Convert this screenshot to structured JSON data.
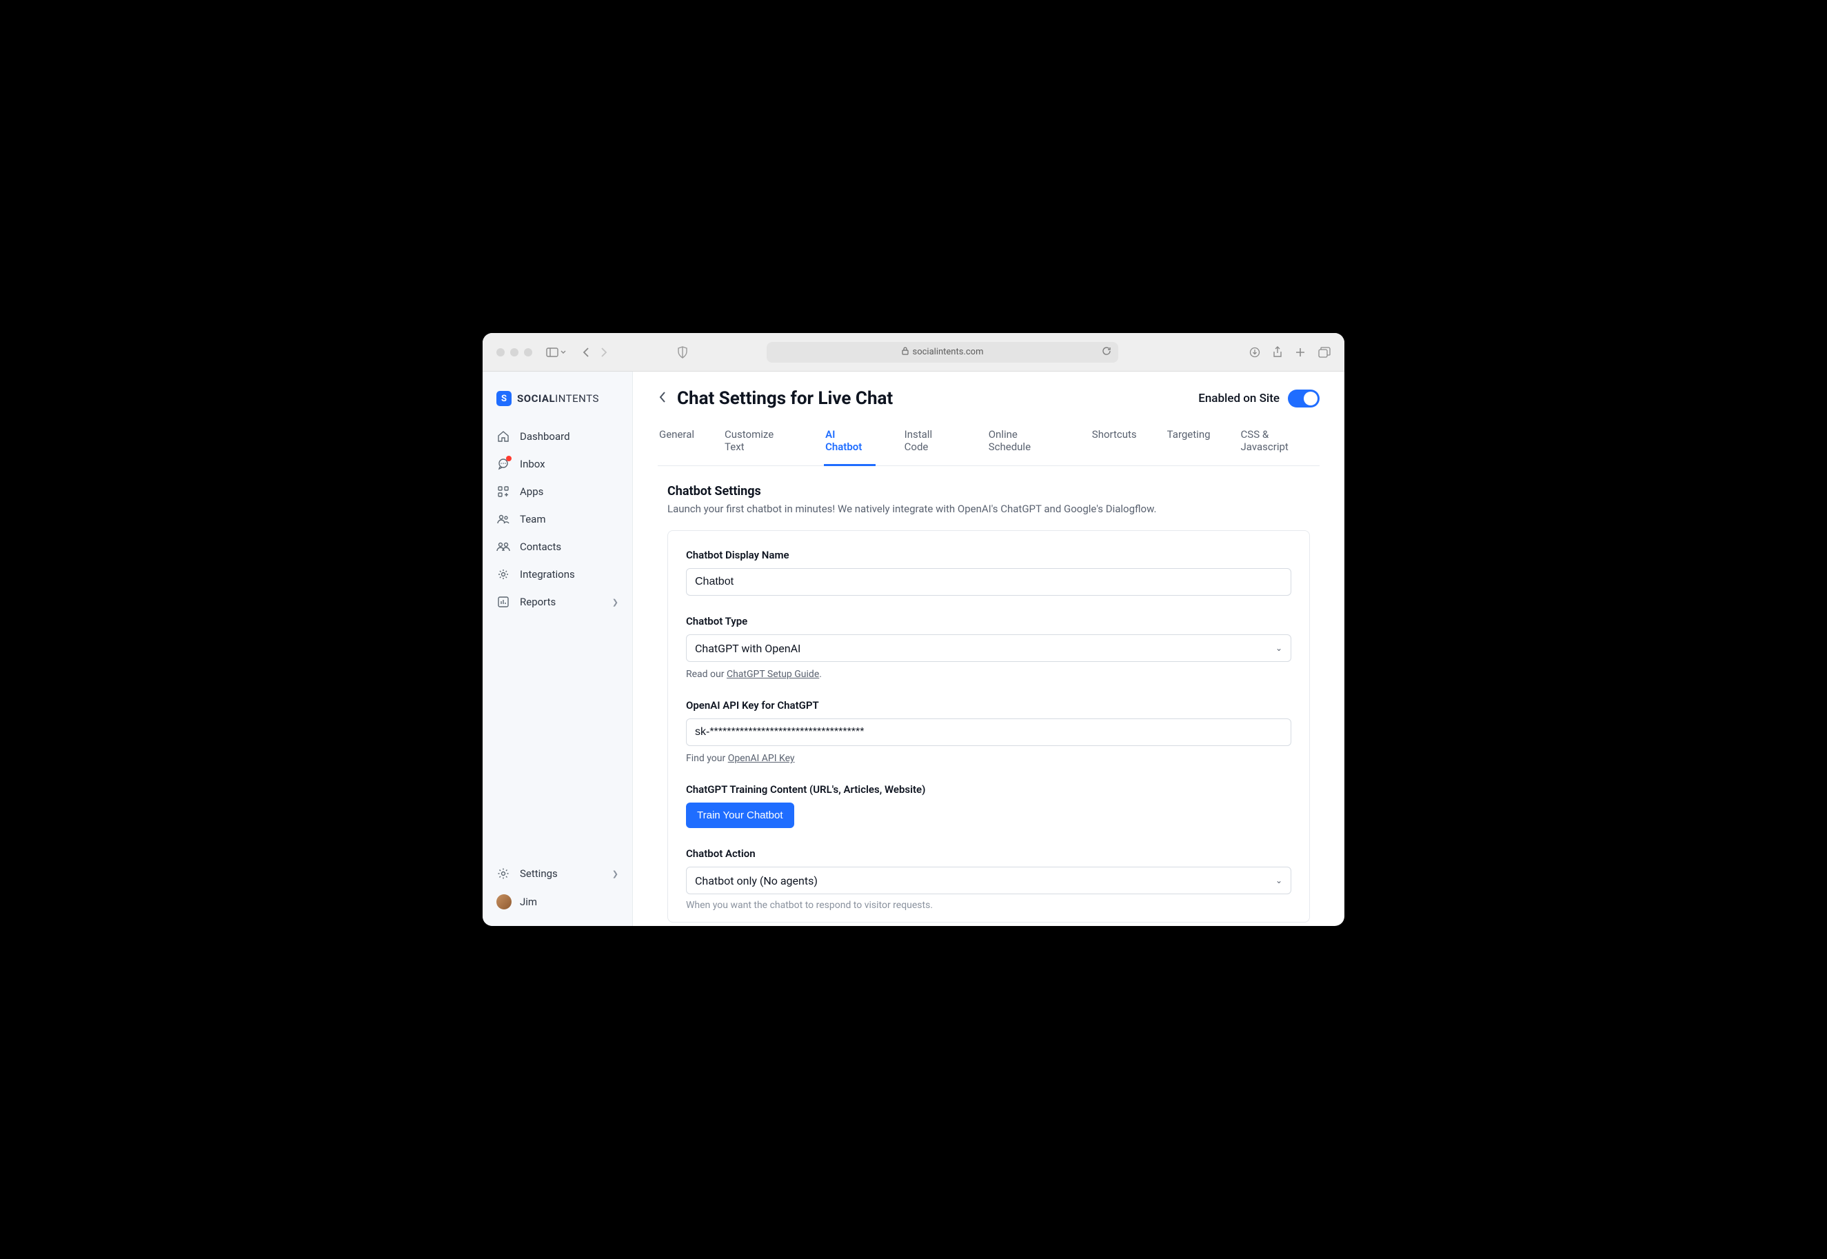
{
  "browser": {
    "url": "socialintents.com"
  },
  "brand": {
    "prefix": "SOCIAL",
    "suffix": "INTENTS"
  },
  "sidebar": {
    "items": [
      {
        "label": "Dashboard"
      },
      {
        "label": "Inbox"
      },
      {
        "label": "Apps"
      },
      {
        "label": "Team"
      },
      {
        "label": "Contacts"
      },
      {
        "label": "Integrations"
      },
      {
        "label": "Reports"
      }
    ],
    "settings_label": "Settings",
    "user_name": "Jim"
  },
  "header": {
    "title": "Chat Settings for Live Chat",
    "enabled_label": "Enabled on Site"
  },
  "tabs": [
    {
      "label": "General"
    },
    {
      "label": "Customize Text"
    },
    {
      "label": "AI Chatbot"
    },
    {
      "label": "Install Code"
    },
    {
      "label": "Online Schedule"
    },
    {
      "label": "Shortcuts"
    },
    {
      "label": "Targeting"
    },
    {
      "label": "CSS & Javascript"
    }
  ],
  "section": {
    "title": "Chatbot Settings",
    "subtitle": "Launch your first chatbot in minutes! We natively integrate with OpenAI's ChatGPT and Google's Dialogflow."
  },
  "form": {
    "display_name_label": "Chatbot Display Name",
    "display_name_value": "Chatbot",
    "type_label": "Chatbot Type",
    "type_value": "ChatGPT with OpenAI",
    "type_hint_prefix": "Read our ",
    "type_hint_link": "ChatGPT Setup Guide",
    "api_key_label": "OpenAI API Key for ChatGPT",
    "api_key_value": "sk-************************************",
    "api_key_hint_prefix": "Find your ",
    "api_key_hint_link": "OpenAI API Key",
    "training_label": "ChatGPT Training Content (URL's, Articles, Website)",
    "train_button": "Train Your Chatbot",
    "action_label": "Chatbot Action",
    "action_value": "Chatbot only (No agents)",
    "action_hint": "When you want the chatbot to respond to visitor requests."
  }
}
